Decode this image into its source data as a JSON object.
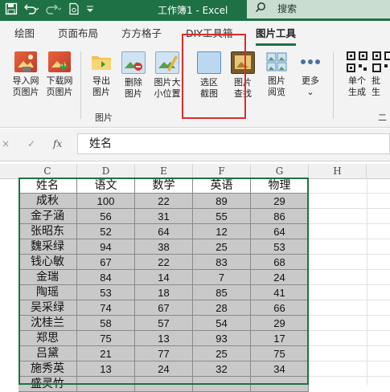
{
  "titlebar": {
    "title": "工作簿1 - Excel",
    "search_label": "搜索",
    "save_icon": "save-icon",
    "undo_icon": "undo-icon",
    "redo_icon": "redo-icon",
    "doc_icon": "document-icon",
    "bg_color": "#1e7145"
  },
  "tabs": [
    {
      "label": "绘图"
    },
    {
      "label": "页面布局"
    },
    {
      "label": "方方格子"
    },
    {
      "label": "DIY工具箱"
    },
    {
      "label": "图片工具",
      "active": true
    }
  ],
  "ribbon": {
    "buttons": [
      {
        "line1": "导入网",
        "line2": "页图片"
      },
      {
        "line1": "下载网",
        "line2": "页图片"
      },
      {
        "line1": "导出",
        "line2": "图片"
      },
      {
        "line1": "删除",
        "line2": "图片"
      },
      {
        "line1": "图片大",
        "line2": "小位置"
      },
      {
        "line1": "选区",
        "line2": "截图"
      },
      {
        "line1": "图片",
        "line2": "查找"
      },
      {
        "line1": "图片",
        "line2": "阅览"
      },
      {
        "line1": "更多",
        "line2": "⌄"
      },
      {
        "line1": "单个",
        "line2": "生成"
      },
      {
        "line1": "批",
        "line2": "生"
      }
    ],
    "group_label": "图片",
    "group_label2": "二"
  },
  "formula_bar": {
    "cancel": "×",
    "confirm": "✓",
    "fx": "fx",
    "value": "姓名"
  },
  "columns": [
    "C",
    "D",
    "E",
    "F",
    "G",
    "H"
  ],
  "table": {
    "headers": [
      "姓名",
      "语文",
      "数学",
      "英语",
      "物理"
    ],
    "rows": [
      [
        "成秋",
        "100",
        "22",
        "89",
        "29"
      ],
      [
        "金子涵",
        "56",
        "31",
        "55",
        "86"
      ],
      [
        "张昭东",
        "52",
        "64",
        "12",
        "64"
      ],
      [
        "魏采绿",
        "94",
        "38",
        "25",
        "53"
      ],
      [
        "钱心敏",
        "67",
        "22",
        "83",
        "68"
      ],
      [
        "金瑞",
        "84",
        "14",
        "7",
        "24"
      ],
      [
        "陶瑶",
        "53",
        "18",
        "85",
        "41"
      ],
      [
        "吴采绿",
        "74",
        "67",
        "28",
        "66"
      ],
      [
        "沈桂兰",
        "58",
        "57",
        "54",
        "29"
      ],
      [
        "郑思",
        "75",
        "13",
        "93",
        "17"
      ],
      [
        "吕黛",
        "21",
        "77",
        "25",
        "75"
      ],
      [
        "施秀英",
        "13",
        "24",
        "32",
        "34"
      ],
      [
        "盛灵竹",
        "",
        "",
        "",
        ""
      ]
    ],
    "header_bg": "#ffffff",
    "row_bg": "#c9c9c9"
  }
}
